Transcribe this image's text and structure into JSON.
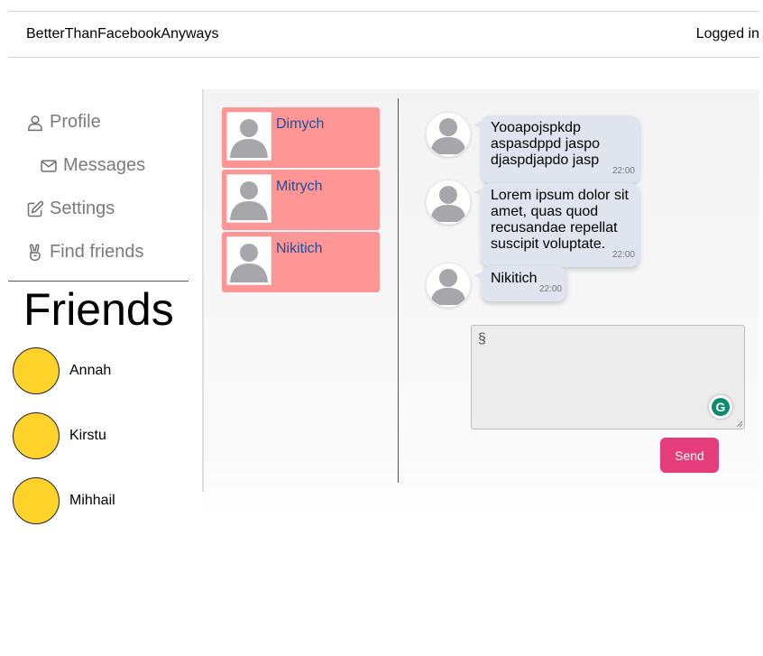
{
  "header": {
    "brand": "BetterThanFacebookAnyways",
    "auth_status": "Logged in"
  },
  "nav": [
    {
      "label": "Profile",
      "icon": "user-icon"
    },
    {
      "label": "Messages",
      "icon": "envelope-icon"
    },
    {
      "label": "Settings",
      "icon": "edit-icon"
    },
    {
      "label": "Find friends",
      "icon": "peace-hand-icon"
    }
  ],
  "friends": {
    "title": "Friends",
    "items": [
      {
        "name": "Annah"
      },
      {
        "name": "Kirstu"
      },
      {
        "name": "Mihhail"
      }
    ]
  },
  "dialogs": [
    {
      "name": "Dimych"
    },
    {
      "name": "Mitrych"
    },
    {
      "name": "Nikitich"
    }
  ],
  "messages": [
    {
      "text": "Yooapojspkdp aspasdppd jaspo djaspdjapdo jasp",
      "time": "22:00"
    },
    {
      "text": "Lorem ipsum dolor sit amet, quas quod recusandae repellat suscipit voluptate.",
      "time": "22:00"
    },
    {
      "text": "Nikitich",
      "time": "22:00"
    }
  ],
  "composer": {
    "value": "§",
    "send_label": "Send"
  },
  "colors": {
    "friend_avatar": "#ffd32a",
    "dialog_bg": "#ff9595",
    "dialog_name": "#1f4f9c",
    "bubble_bg": "#dfe4ef",
    "send_button": "#e43d7a",
    "grammar_icon": "#0e8a6d"
  }
}
